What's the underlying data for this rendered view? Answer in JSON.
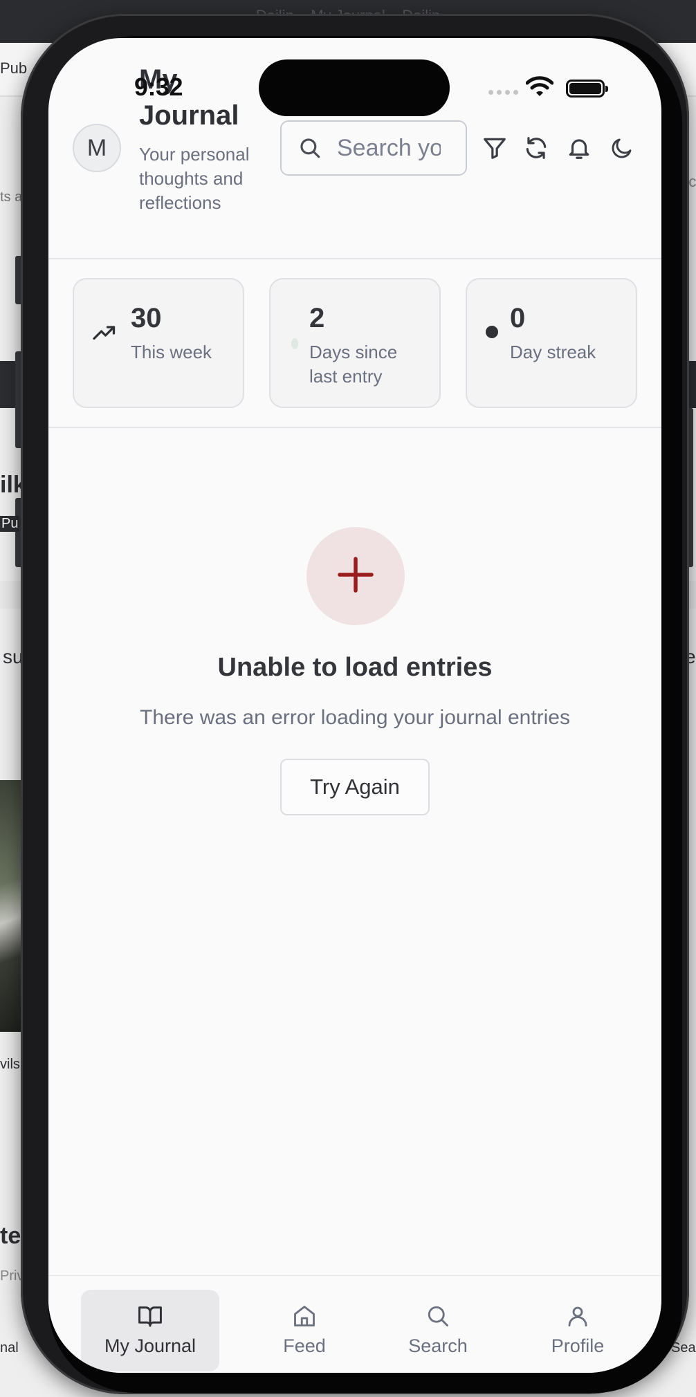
{
  "background": {
    "window_title": "Dailin – My Journal – Dailin",
    "fragments": {
      "left_pub": "Pub",
      "left_ts": "ts a",
      "left_ilk": "ilk",
      "left_pu": "Pu",
      "left_su": "su",
      "left_vils": "vils",
      "left_te": "te",
      "left_priv": "Priv",
      "left_nal": "nal",
      "right_ple": "ple",
      "right_rc": "rc",
      "right_e": "e",
      "right_sea": "Sea"
    }
  },
  "status_bar": {
    "time": "9:32"
  },
  "header": {
    "avatar_initial": "M",
    "title": "My Journal",
    "subtitle": "Your personal thoughts and reflections",
    "search_placeholder": "Search your entries",
    "icons": [
      "filter-icon",
      "refresh-icon",
      "bell-icon",
      "moon-icon"
    ]
  },
  "stats": [
    {
      "value": "30",
      "label": "This week",
      "icon": "trending-up-icon"
    },
    {
      "value": "2",
      "label": "Days since last entry",
      "icon": "status-dot-icon"
    },
    {
      "value": "0",
      "label": "Day streak",
      "icon": "dot-icon"
    }
  ],
  "error_state": {
    "icon": "plus-icon",
    "title": "Unable to load entries",
    "message": "There was an error loading your journal entries",
    "retry_label": "Try Again"
  },
  "bottom_nav": {
    "items": [
      {
        "label": "My Journal",
        "icon": "book-open-icon",
        "active": true
      },
      {
        "label": "Feed",
        "icon": "home-icon",
        "active": false
      },
      {
        "label": "Search",
        "icon": "search-icon",
        "active": false
      },
      {
        "label": "Profile",
        "icon": "user-icon",
        "active": false
      }
    ]
  },
  "colors": {
    "accent_red": "#9b1c1c",
    "error_circle_bg": "#f0e2e2",
    "muted_text": "#6b7080",
    "primary_text": "#2f3136"
  }
}
